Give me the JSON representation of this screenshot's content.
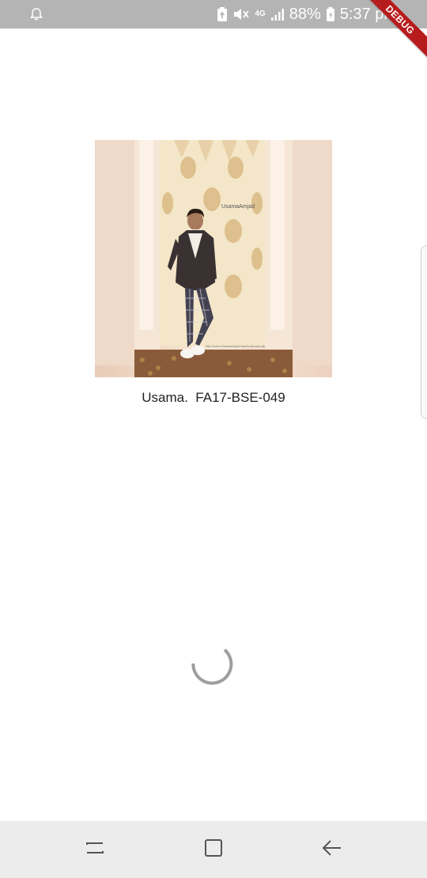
{
  "status_bar": {
    "network": "4G",
    "battery_percent": "88%",
    "time": "5:37 pm",
    "icons": [
      "notification-bell-icon",
      "battery-saver-icon",
      "mute-icon",
      "signal-icon",
      "battery-charging-icon"
    ]
  },
  "debug_banner": {
    "label": "DEBUG",
    "color": "#b71c1c"
  },
  "profile": {
    "photo_watermark": "UsamaAmjad",
    "caption": "Usama.  FA17-BSE-049"
  },
  "loading": {
    "spinner_color": "#9e9e9e"
  },
  "nav_bar": {
    "buttons": [
      "recent-apps-icon",
      "home-icon",
      "back-icon"
    ]
  }
}
